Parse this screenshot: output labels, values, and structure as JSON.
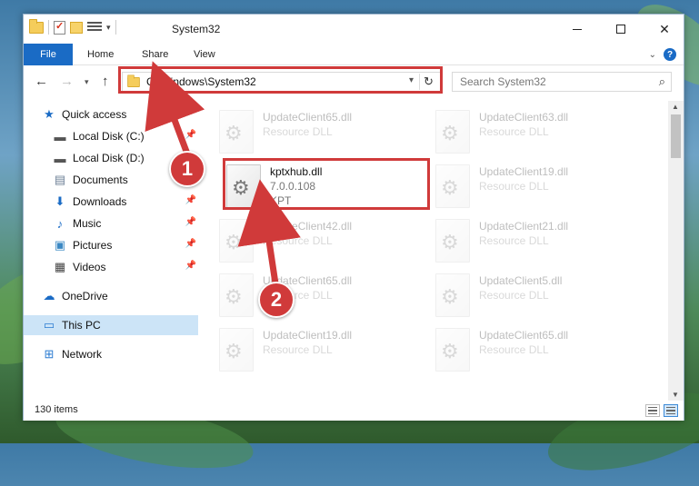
{
  "window": {
    "title": "System32",
    "colors": {
      "accent": "#1a6bc5",
      "highlight": "#d03a3a",
      "selected": "#cce4f7"
    }
  },
  "ribbon": {
    "file": "File",
    "home": "Home",
    "share": "Share",
    "view": "View"
  },
  "address": {
    "path": "C:\\Windows\\System32"
  },
  "search": {
    "placeholder": "Search System32"
  },
  "sidebar": {
    "items": [
      {
        "label": "Quick access",
        "icon": "star-icon"
      },
      {
        "label": "Local Disk (C:)",
        "icon": "drive-icon"
      },
      {
        "label": "Local Disk (D:)",
        "icon": "drive-icon"
      },
      {
        "label": "Documents",
        "icon": "documents-icon"
      },
      {
        "label": "Downloads",
        "icon": "download-icon"
      },
      {
        "label": "Music",
        "icon": "music-icon"
      },
      {
        "label": "Pictures",
        "icon": "pictures-icon"
      },
      {
        "label": "Videos",
        "icon": "videos-icon"
      },
      {
        "label": "OneDrive",
        "icon": "cloud-icon"
      },
      {
        "label": "This PC",
        "icon": "computer-icon"
      },
      {
        "label": "Network",
        "icon": "network-icon"
      }
    ]
  },
  "files": [
    {
      "name": "UpdateClient65.dll",
      "sub": "Resource DLL"
    },
    {
      "name": "UpdateClient63.dll",
      "sub": "Resource DLL"
    },
    {
      "name": "kptxhub.dll",
      "sub": "7.0.0.108",
      "sub2": "KPT"
    },
    {
      "name": "UpdateClient19.dll",
      "sub": "Resource DLL"
    },
    {
      "name": "UpdateClient42.dll",
      "sub": "Resource DLL"
    },
    {
      "name": "UpdateClient21.dll",
      "sub": "Resource DLL"
    },
    {
      "name": "UpdateClient65.dll",
      "sub": "Resource DLL"
    },
    {
      "name": "UpdateClient5.dll",
      "sub": "Resource DLL"
    },
    {
      "name": "UpdateClient19.dll",
      "sub": "Resource DLL"
    },
    {
      "name": "UpdateClient65.dll",
      "sub": "Resource DLL"
    }
  ],
  "status": {
    "count": "130 items"
  },
  "callouts": {
    "one": "1",
    "two": "2"
  }
}
